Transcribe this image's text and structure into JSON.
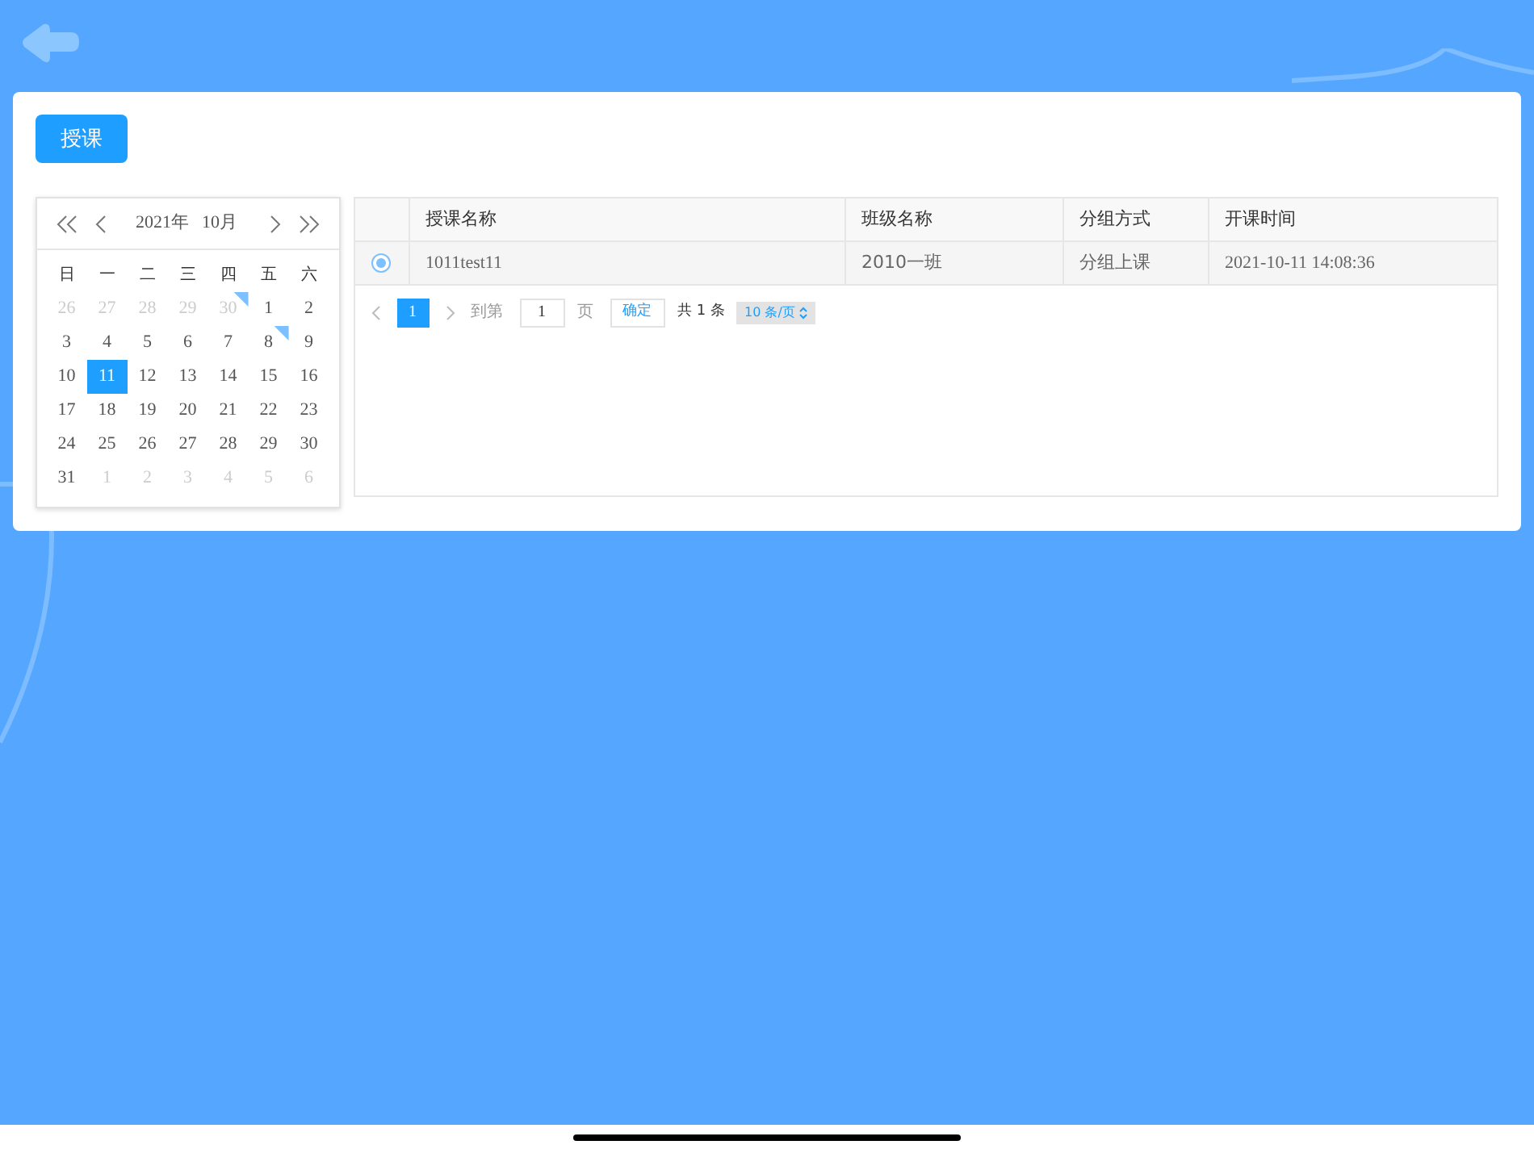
{
  "toolbar": {
    "button": "授课"
  },
  "calendar": {
    "year_label": "2021年",
    "month_label": "10月",
    "weekdays": [
      "日",
      "一",
      "二",
      "三",
      "四",
      "五",
      "六"
    ],
    "days": [
      {
        "label": "26",
        "muted": true,
        "selected": false,
        "marked": false
      },
      {
        "label": "27",
        "muted": true,
        "selected": false,
        "marked": false
      },
      {
        "label": "28",
        "muted": true,
        "selected": false,
        "marked": false
      },
      {
        "label": "29",
        "muted": true,
        "selected": false,
        "marked": false
      },
      {
        "label": "30",
        "muted": true,
        "selected": false,
        "marked": true
      },
      {
        "label": "1",
        "muted": false,
        "selected": false,
        "marked": false
      },
      {
        "label": "2",
        "muted": false,
        "selected": false,
        "marked": false
      },
      {
        "label": "3",
        "muted": false,
        "selected": false,
        "marked": false
      },
      {
        "label": "4",
        "muted": false,
        "selected": false,
        "marked": false
      },
      {
        "label": "5",
        "muted": false,
        "selected": false,
        "marked": false
      },
      {
        "label": "6",
        "muted": false,
        "selected": false,
        "marked": false
      },
      {
        "label": "7",
        "muted": false,
        "selected": false,
        "marked": false
      },
      {
        "label": "8",
        "muted": false,
        "selected": false,
        "marked": true
      },
      {
        "label": "9",
        "muted": false,
        "selected": false,
        "marked": false
      },
      {
        "label": "10",
        "muted": false,
        "selected": false,
        "marked": false
      },
      {
        "label": "11",
        "muted": false,
        "selected": true,
        "marked": false
      },
      {
        "label": "12",
        "muted": false,
        "selected": false,
        "marked": false
      },
      {
        "label": "13",
        "muted": false,
        "selected": false,
        "marked": false
      },
      {
        "label": "14",
        "muted": false,
        "selected": false,
        "marked": false
      },
      {
        "label": "15",
        "muted": false,
        "selected": false,
        "marked": false
      },
      {
        "label": "16",
        "muted": false,
        "selected": false,
        "marked": false
      },
      {
        "label": "17",
        "muted": false,
        "selected": false,
        "marked": false
      },
      {
        "label": "18",
        "muted": false,
        "selected": false,
        "marked": false
      },
      {
        "label": "19",
        "muted": false,
        "selected": false,
        "marked": false
      },
      {
        "label": "20",
        "muted": false,
        "selected": false,
        "marked": false
      },
      {
        "label": "21",
        "muted": false,
        "selected": false,
        "marked": false
      },
      {
        "label": "22",
        "muted": false,
        "selected": false,
        "marked": false
      },
      {
        "label": "23",
        "muted": false,
        "selected": false,
        "marked": false
      },
      {
        "label": "24",
        "muted": false,
        "selected": false,
        "marked": false
      },
      {
        "label": "25",
        "muted": false,
        "selected": false,
        "marked": false
      },
      {
        "label": "26",
        "muted": false,
        "selected": false,
        "marked": false
      },
      {
        "label": "27",
        "muted": false,
        "selected": false,
        "marked": false
      },
      {
        "label": "28",
        "muted": false,
        "selected": false,
        "marked": false
      },
      {
        "label": "29",
        "muted": false,
        "selected": false,
        "marked": false
      },
      {
        "label": "30",
        "muted": false,
        "selected": false,
        "marked": false
      },
      {
        "label": "31",
        "muted": false,
        "selected": false,
        "marked": false
      },
      {
        "label": "1",
        "muted": true,
        "selected": false,
        "marked": false
      },
      {
        "label": "2",
        "muted": true,
        "selected": false,
        "marked": false
      },
      {
        "label": "3",
        "muted": true,
        "selected": false,
        "marked": false
      },
      {
        "label": "4",
        "muted": true,
        "selected": false,
        "marked": false
      },
      {
        "label": "5",
        "muted": true,
        "selected": false,
        "marked": false
      },
      {
        "label": "6",
        "muted": true,
        "selected": false,
        "marked": false
      }
    ]
  },
  "table": {
    "columns": [
      "授课名称",
      "班级名称",
      "分组方式",
      "开课时间"
    ],
    "rows": [
      {
        "selected": true,
        "cells": [
          "1011test11",
          "2010一班",
          "分组上课",
          "2021-10-11 14:08:36"
        ]
      }
    ]
  },
  "pagination": {
    "pages": [
      {
        "label": "1",
        "selected": true
      }
    ],
    "goto_label": "到第",
    "goto_value": "1",
    "page_unit": "页",
    "confirm": "确定",
    "total": "共 1 条",
    "page_size": "10 条/页"
  }
}
